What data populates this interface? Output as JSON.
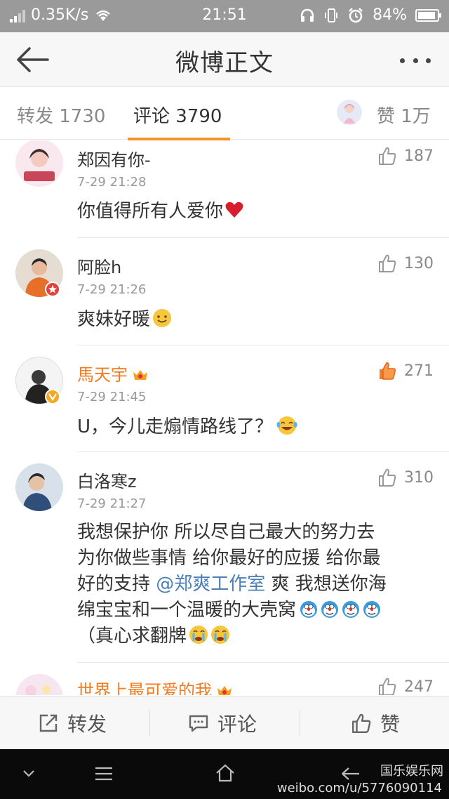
{
  "status_bar": {
    "speed": "0.35K/s",
    "time": "21:51",
    "battery": "84%"
  },
  "header": {
    "title": "微博正文",
    "back_icon": "back-arrow-icon",
    "more_icon": "more-dots-icon"
  },
  "tabs": {
    "repost": "转发 1730",
    "comments": "评论 3790",
    "likes": "赞 1万"
  },
  "comments": [
    {
      "user": "郑因有你-",
      "time": "7-29 21:28",
      "text": "你值得所有人爱你",
      "emoji": "heart",
      "likes": "187",
      "liked": false
    },
    {
      "user": "阿脸h",
      "time": "7-29 21:26",
      "text": "爽妹好暖",
      "emoji": "smile",
      "likes": "130",
      "liked": false
    },
    {
      "user": "馬天宇",
      "time": "7-29 21:45",
      "text": "U，今儿走煽情路线了？",
      "emoji": "laugh-cry",
      "likes": "271",
      "liked": true,
      "vip": true
    },
    {
      "user": "白洛寒z",
      "time": "7-29 21:27",
      "line1": "我想保护你  所以尽自己最大的努力去",
      "line2": "为你做些事情  给你最好的应援  给你最",
      "line3_a": "好的支持 ",
      "mention": "@郑爽工作室",
      "line3_b": " 爽 我想送你海",
      "line4": "绵宝宝和一个温暖的大壳窝",
      "line5": "（真心求翻牌",
      "likes": "310",
      "liked": false
    },
    {
      "user": "世界上最可爱的我",
      "likes": "247",
      "liked": false,
      "vip": true
    }
  ],
  "bottom_actions": {
    "repost": "转发",
    "comment": "评论",
    "like": "赞"
  },
  "watermark": {
    "site": "weibo.com/u/5776090114",
    "brand": "国乐娱乐网"
  },
  "colors": {
    "accent": "#f7912a",
    "vip_name": "#f37a1e",
    "mention": "#4a7fb8"
  }
}
